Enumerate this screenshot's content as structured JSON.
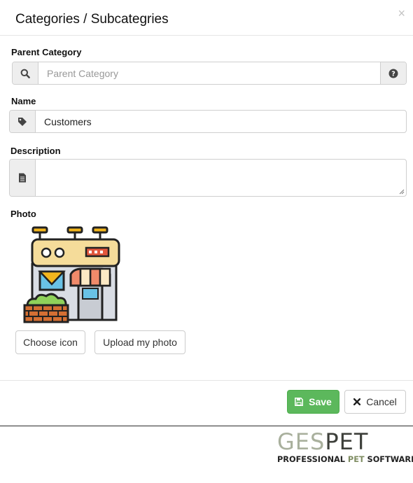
{
  "modal": {
    "title": "Categories / Subcategries",
    "close_symbol": "×"
  },
  "parent_category": {
    "label": "Parent Category",
    "placeholder": "Parent Category",
    "left_icon": "search-icon",
    "right_icon": "question-circle-icon"
  },
  "name": {
    "label": "Name",
    "value": "Customers",
    "icon": "tag-icon"
  },
  "description": {
    "label": "Description",
    "value": "",
    "icon": "file-text-icon"
  },
  "photo": {
    "label": "Photo",
    "image": "pet-shop-storefront-icon",
    "choose_icon_label": "Choose icon",
    "upload_label": "Upload my photo"
  },
  "footer": {
    "save_label": "Save",
    "save_icon": "floppy-disk-icon",
    "cancel_label": "Cancel",
    "cancel_icon": "x-icon",
    "save_color": "#5cb85c"
  },
  "brand": {
    "name_ges": "GES",
    "name_pet": "PET",
    "tag_a": "PROFESSIONAL ",
    "tag_pet": "PET",
    "tag_b": " SOFTWARE"
  }
}
